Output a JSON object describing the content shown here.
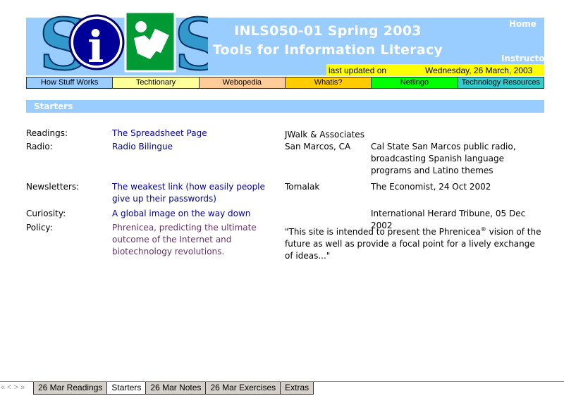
{
  "header": {
    "title_line1": "INLS050-01 Spring 2003",
    "title_line2": "Tools for Information Literacy",
    "home_link": "Home",
    "instructor_link": "Instructor",
    "updated_label": "last updated on",
    "updated_date": "Wednesday, 26 March, 2003",
    "logo_letters": "SiLS"
  },
  "nav": [
    {
      "label": "How Stuff Works",
      "color": "#99ccff"
    },
    {
      "label": "Techtionary",
      "color": "#ffff99"
    },
    {
      "label": "Webopedia",
      "color": "#ffcc99"
    },
    {
      "label": "Whatis?",
      "color": "#ffcc00"
    },
    {
      "label": "Netlingo",
      "color": "#00ff00"
    },
    {
      "label": "Technology Resources",
      "color": "#33cccc"
    }
  ],
  "section": {
    "title": "Starters"
  },
  "rows": [
    {
      "category": "Readings:",
      "link": "The Spreadsheet Page",
      "source": "JWalk & Associates",
      "desc": ""
    },
    {
      "category": "Radio:",
      "link": "Radio Bilingue",
      "source": "San Marcos, CA",
      "desc": "Cal State San Marcos public radio, broadcasting Spanish language programs and Latino themes"
    },
    {
      "category": "Newsletters:",
      "link": "The weakest link (how easily people give up their passwords)",
      "source": "Tomalak",
      "desc": "The Economist, 24 Oct 2002"
    },
    {
      "category": "Curiosity:",
      "link": "A global image on the way down",
      "source": "",
      "desc": "International Herard Tribune, 05 Dec 2002"
    },
    {
      "category": "Policy:",
      "link": "Phrenicea, predicting the ultimate outcome of the Internet and biotechnology revolutions.",
      "quote_before": "\"This site is intended to present the Phrenicea",
      "quote_sup": "®",
      "quote_after": " vision of the future as well as provide a focal point for a lively exchange of ideas...\""
    }
  ],
  "tabbar": {
    "nav_symbols": [
      "«",
      "<",
      ">",
      "»"
    ],
    "tabs": [
      "26 Mar Readings",
      "Starters",
      "26 Mar Notes",
      "26 Mar Exercises",
      "Extras"
    ],
    "active_index": 1
  }
}
